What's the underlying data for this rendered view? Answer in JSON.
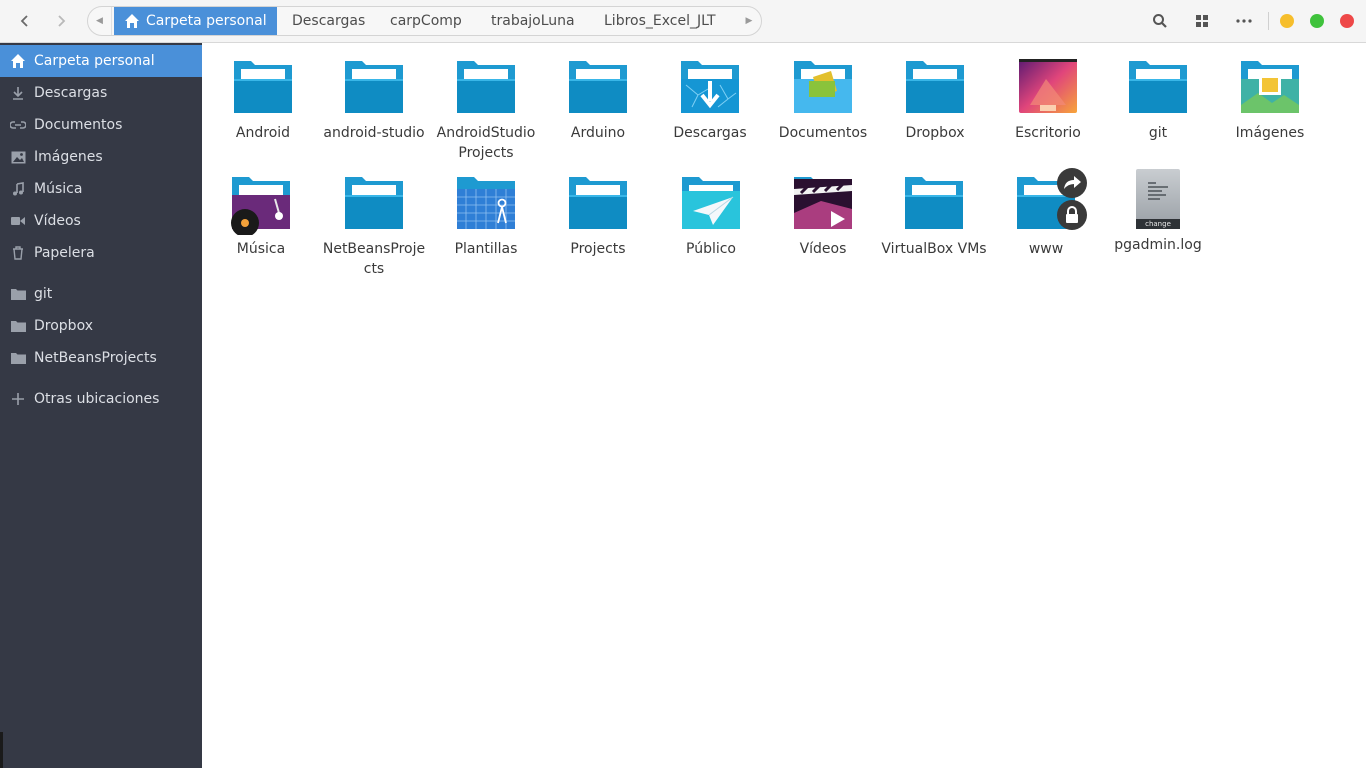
{
  "header": {
    "breadcrumbs": [
      "Carpeta personal",
      "Descargas",
      "carpComp",
      "trabajoLuna",
      "Libros_Excel_JLT"
    ]
  },
  "sidebar": {
    "places": [
      {
        "label": "Carpeta personal",
        "icon": "home-icon",
        "active": true
      },
      {
        "label": "Descargas",
        "icon": "download-icon"
      },
      {
        "label": "Documentos",
        "icon": "document-icon"
      },
      {
        "label": "Imágenes",
        "icon": "image-icon"
      },
      {
        "label": "Música",
        "icon": "music-icon"
      },
      {
        "label": "Vídeos",
        "icon": "video-icon"
      },
      {
        "label": "Papelera",
        "icon": "trash-icon"
      }
    ],
    "bookmarks": [
      {
        "label": "git",
        "icon": "folder-icon"
      },
      {
        "label": "Dropbox",
        "icon": "folder-icon"
      },
      {
        "label": "NetBeansProjects",
        "icon": "folder-icon"
      }
    ],
    "other": {
      "label": "Otras ubicaciones",
      "icon": "plus-icon"
    }
  },
  "files": [
    {
      "name": "Android",
      "type": "folder"
    },
    {
      "name": "android-studio",
      "type": "folder"
    },
    {
      "name": "AndroidStudio Projects",
      "type": "folder"
    },
    {
      "name": "Arduino",
      "type": "folder"
    },
    {
      "name": "Descargas",
      "type": "folder-downloads"
    },
    {
      "name": "Documentos",
      "type": "folder-documents"
    },
    {
      "name": "Dropbox",
      "type": "folder"
    },
    {
      "name": "Escritorio",
      "type": "folder-desktop"
    },
    {
      "name": "git",
      "type": "folder"
    },
    {
      "name": "Imágenes",
      "type": "folder-pictures"
    },
    {
      "name": "Música",
      "type": "folder-music"
    },
    {
      "name": "NetBeansProje cts",
      "type": "folder"
    },
    {
      "name": "Plantillas",
      "type": "folder-templates"
    },
    {
      "name": "Projects",
      "type": "folder"
    },
    {
      "name": "Público",
      "type": "folder-public"
    },
    {
      "name": "Vídeos",
      "type": "folder-videos"
    },
    {
      "name": "VirtualBox VMs",
      "type": "folder"
    },
    {
      "name": "www",
      "type": "folder-link-locked"
    },
    {
      "name": "pgadmin.log",
      "type": "text-log",
      "badge": "change"
    }
  ]
}
